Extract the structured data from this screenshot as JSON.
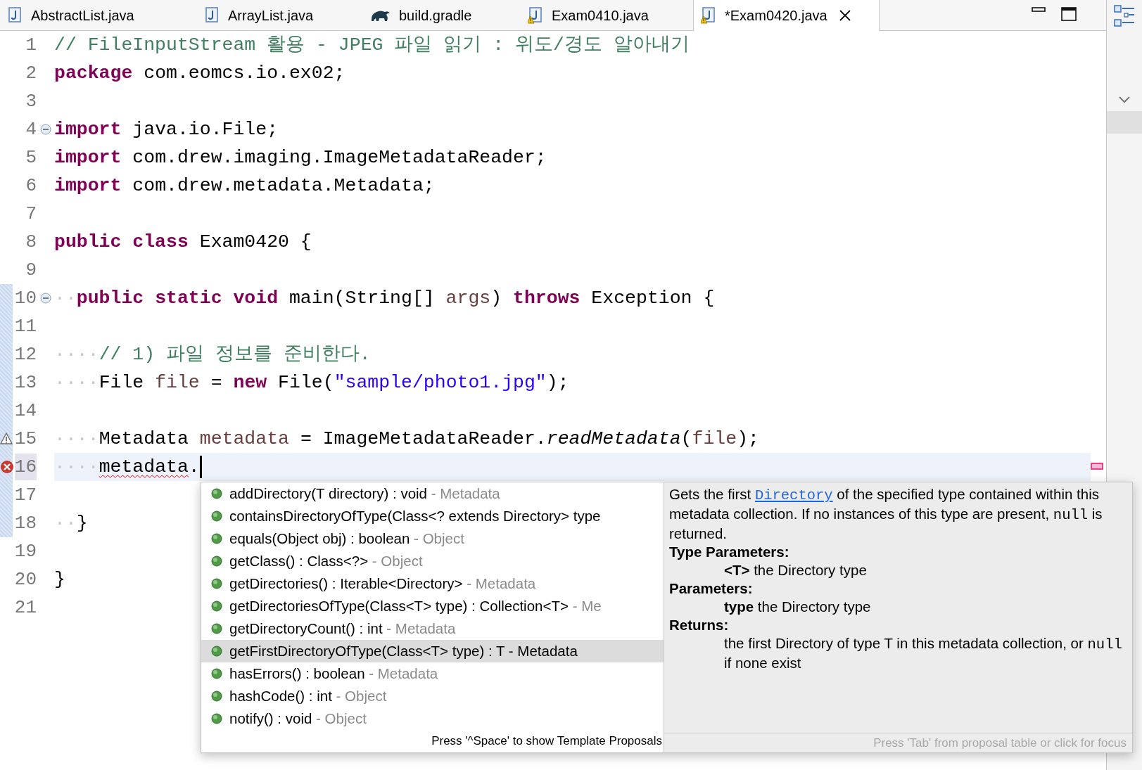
{
  "tabs": [
    {
      "label": "AbstractList.java",
      "kind": "java",
      "selected": false
    },
    {
      "label": "ArrayList.java",
      "kind": "java",
      "selected": false
    },
    {
      "label": "build.gradle",
      "kind": "gradle",
      "selected": false
    },
    {
      "label": "Exam0410.java",
      "kind": "java-warning",
      "selected": false
    },
    {
      "label": "*Exam0420.java",
      "kind": "java-warning",
      "selected": true
    }
  ],
  "lines": [
    {
      "number": "1",
      "current": false,
      "in_range": false,
      "foldable": false,
      "tokens": [
        {
          "kind": "comment",
          "text": "// FileInputStream 활용 - JPEG 파일 읽기 : 위도/경도 알아내기"
        }
      ]
    },
    {
      "number": "2",
      "current": false,
      "in_range": false,
      "foldable": false,
      "tokens": [
        {
          "kind": "keyword",
          "text": "package"
        },
        {
          "kind": "plain",
          "text": " com.eomcs.io.ex02;"
        }
      ]
    },
    {
      "number": "3",
      "current": false,
      "in_range": false,
      "foldable": false
    },
    {
      "number": "4",
      "current": false,
      "in_range": false,
      "foldable": true,
      "tokens": [
        {
          "kind": "keyword",
          "text": "import"
        },
        {
          "kind": "plain",
          "text": " java.io.File;"
        }
      ]
    },
    {
      "number": "5",
      "current": false,
      "in_range": false,
      "foldable": false,
      "tokens": [
        {
          "kind": "keyword",
          "text": "import"
        },
        {
          "kind": "plain",
          "text": " com.drew.imaging.ImageMetadataReader;"
        }
      ]
    },
    {
      "number": "6",
      "current": false,
      "in_range": false,
      "foldable": false,
      "tokens": [
        {
          "kind": "keyword",
          "text": "import"
        },
        {
          "kind": "plain",
          "text": " com.drew.metadata.Metadata;"
        }
      ]
    },
    {
      "number": "7",
      "current": false,
      "in_range": false,
      "foldable": false
    },
    {
      "number": "8",
      "current": false,
      "in_range": false,
      "foldable": false,
      "tokens": [
        {
          "kind": "keyword",
          "text": "public class"
        },
        {
          "kind": "plain",
          "text": " Exam0420 {"
        }
      ]
    },
    {
      "number": "9",
      "current": false,
      "in_range": false,
      "foldable": false
    },
    {
      "number": "10",
      "current": false,
      "in_range": true,
      "foldable": true,
      "tokens": [
        {
          "kind": "whitespace",
          "text": "··"
        },
        {
          "kind": "keyword",
          "text": "public static void"
        },
        {
          "kind": "plain",
          "text": " main(String[] "
        },
        {
          "kind": "variable",
          "text": "args"
        },
        {
          "kind": "plain",
          "text": ") "
        },
        {
          "kind": "keyword",
          "text": "throws"
        },
        {
          "kind": "plain",
          "text": " Exception {"
        }
      ]
    },
    {
      "number": "11",
      "current": false,
      "in_range": true,
      "foldable": false
    },
    {
      "number": "12",
      "current": false,
      "in_range": true,
      "foldable": false,
      "tokens": [
        {
          "kind": "whitespace",
          "text": "····"
        },
        {
          "kind": "comment",
          "text": "// 1) 파일 정보를 준비한다."
        }
      ]
    },
    {
      "number": "13",
      "current": false,
      "in_range": true,
      "foldable": false,
      "tokens": [
        {
          "kind": "whitespace",
          "text": "····"
        },
        {
          "kind": "plain",
          "text": "File "
        },
        {
          "kind": "variable",
          "text": "file"
        },
        {
          "kind": "plain",
          "text": " = "
        },
        {
          "kind": "keyword",
          "text": "new"
        },
        {
          "kind": "plain",
          "text": " File("
        },
        {
          "kind": "string",
          "text": "\"sample/photo1.jpg\""
        },
        {
          "kind": "plain",
          "text": ");"
        }
      ]
    },
    {
      "number": "14",
      "current": false,
      "in_range": true,
      "foldable": false
    },
    {
      "number": "15",
      "current": false,
      "in_range": true,
      "foldable": false,
      "problem": {
        "kind": "warning"
      },
      "tokens": [
        {
          "kind": "whitespace",
          "text": "····"
        },
        {
          "kind": "plain",
          "text": "Metadata "
        },
        {
          "kind": "variable",
          "text": "metadata"
        },
        {
          "kind": "plain",
          "text": " = ImageMetadataReader."
        },
        {
          "kind": "static",
          "text": "readMetadata"
        },
        {
          "kind": "plain",
          "text": "("
        },
        {
          "kind": "variable",
          "text": "file"
        },
        {
          "kind": "plain",
          "text": ");"
        }
      ]
    },
    {
      "number": "16",
      "current": true,
      "in_range": true,
      "foldable": false,
      "problem": {
        "kind": "error"
      },
      "caret": true,
      "tokens": [
        {
          "kind": "whitespace",
          "text": "····"
        },
        {
          "kind": "error",
          "text": "metadata"
        },
        {
          "kind": "plain",
          "text": "."
        }
      ]
    },
    {
      "number": "17",
      "current": false,
      "in_range": true,
      "foldable": false
    },
    {
      "number": "18",
      "current": false,
      "in_range": true,
      "foldable": false,
      "tokens": [
        {
          "kind": "whitespace",
          "text": "··"
        },
        {
          "kind": "plain",
          "text": "}"
        }
      ]
    },
    {
      "number": "19",
      "current": false,
      "in_range": false,
      "foldable": false
    },
    {
      "number": "20",
      "current": false,
      "in_range": false,
      "foldable": false,
      "tokens": [
        {
          "kind": "plain",
          "text": "}"
        }
      ]
    },
    {
      "number": "21",
      "current": false,
      "in_range": false,
      "foldable": false
    }
  ],
  "proposals": {
    "items": [
      {
        "signature": "addDirectory(T directory) : void",
        "owner": " - Metadata",
        "selected": false
      },
      {
        "signature": "containsDirectoryOfType(Class<? extends Directory> type",
        "selected": false
      },
      {
        "signature": "equals(Object obj) : boolean",
        "owner": " - Object",
        "selected": false
      },
      {
        "signature": "getClass() : Class<?>",
        "owner": " - Object",
        "selected": false
      },
      {
        "signature": "getDirectories() : Iterable<Directory>",
        "owner": " - Metadata",
        "selected": false
      },
      {
        "signature": "getDirectoriesOfType(Class<T> type) : Collection<T>",
        "owner": " - Me",
        "selected": false
      },
      {
        "signature": "getDirectoryCount() : int",
        "owner": " - Metadata",
        "selected": false
      },
      {
        "signature": "getFirstDirectoryOfType(Class<T> type) : T",
        "owner": " - Metadata",
        "selected": true
      },
      {
        "signature": "hasErrors() : boolean",
        "owner": " - Metadata",
        "selected": false
      },
      {
        "signature": "hashCode() : int",
        "owner": " - Object",
        "selected": false
      },
      {
        "signature": "notify() : void",
        "owner": " - Object",
        "selected": false
      }
    ],
    "footer": "Press '^Space' to show Template Proposals"
  },
  "doc": {
    "description": [
      {
        "kind": "text",
        "text": "Gets the first "
      },
      {
        "kind": "link",
        "text": "Directory"
      },
      {
        "kind": "text",
        "text": " of the specified type contained within this metadata collection. If no instances of this type are present, "
      },
      {
        "kind": "code",
        "text": "null"
      },
      {
        "kind": "text",
        "text": " is returned."
      }
    ],
    "sections": [
      {
        "heading": "Type Parameters:",
        "entries": [
          [
            {
              "kind": "bold",
              "text": "<T>"
            },
            {
              "kind": "text",
              "text": " the Directory type"
            }
          ]
        ]
      },
      {
        "heading": "Parameters:",
        "entries": [
          [
            {
              "kind": "bold",
              "text": "type"
            },
            {
              "kind": "text",
              "text": " the Directory type"
            }
          ]
        ]
      },
      {
        "heading": "Returns:",
        "entries": [
          [
            {
              "kind": "text",
              "text": "the first Directory of type T in this metadata collection, or "
            },
            {
              "kind": "code",
              "text": "null"
            },
            {
              "kind": "text",
              "text": " if none exist"
            }
          ]
        ]
      }
    ],
    "footer": "Press 'Tab' from proposal table or click for focus"
  }
}
